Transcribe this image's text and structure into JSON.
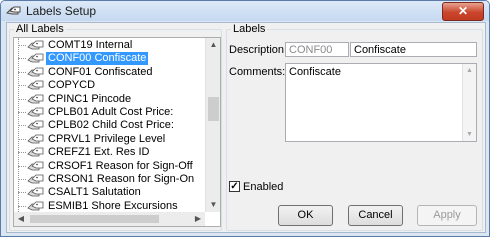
{
  "window": {
    "title": "Labels Setup",
    "close_glyph": "✕"
  },
  "all_labels": {
    "legend": "All Labels",
    "items": [
      {
        "text": "COMT19  Internal",
        "selected": false
      },
      {
        "text": "CONF00  Confiscate",
        "selected": true
      },
      {
        "text": "CONF01  Confiscated",
        "selected": false
      },
      {
        "text": "COPYCD",
        "selected": false
      },
      {
        "text": "CPINC1  Pincode",
        "selected": false
      },
      {
        "text": "CPLB01  Adult Cost Price:",
        "selected": false
      },
      {
        "text": "CPLB02  Child Cost Price:",
        "selected": false
      },
      {
        "text": "CPRVL1  Privilege Level",
        "selected": false
      },
      {
        "text": "CREFZ1  Ext. Res ID",
        "selected": false
      },
      {
        "text": "CRSOF1  Reason for Sign-Off",
        "selected": false
      },
      {
        "text": "CRSON1  Reason for Sign-On",
        "selected": false
      },
      {
        "text": "CSALT1  Salutation",
        "selected": false
      },
      {
        "text": "ESMIB1  Shore Excursions",
        "selected": false
      }
    ]
  },
  "labels": {
    "legend": "Labels",
    "description_label": "Description:",
    "description_code": "CONF00",
    "description_value": "Confiscate",
    "comments_label": "Comments:",
    "comments_value": "Confiscate",
    "enabled_label": "Enabled",
    "enabled_checked": true
  },
  "buttons": {
    "ok": "OK",
    "cancel": "Cancel",
    "apply": "Apply"
  },
  "icons": {
    "app": "labels-app-icon",
    "label_item": "tag-icon"
  }
}
